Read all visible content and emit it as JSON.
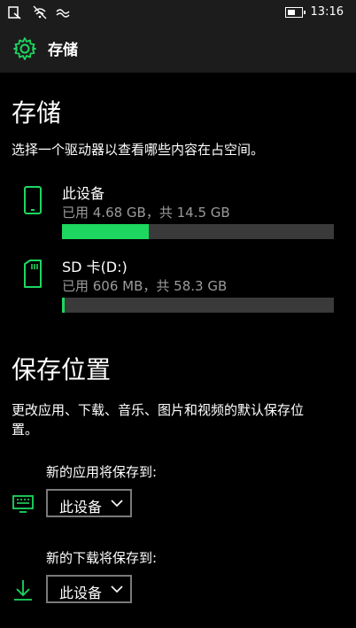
{
  "status_bar": {
    "time": "13:16"
  },
  "header": {
    "title": "存储"
  },
  "storage": {
    "heading": "存储",
    "description": "选择一个驱动器以查看哪些内容在占空间。",
    "drives": [
      {
        "name": "此设备",
        "usage": "已用 4.68 GB，共 14.5 GB",
        "used_fraction": 0.32
      },
      {
        "name": "SD 卡(D:)",
        "usage": "已用 606 MB，共 58.3 GB",
        "used_fraction": 0.01
      }
    ]
  },
  "save_locations": {
    "heading": "保存位置",
    "description_line1": "更改应用、下载、音乐、图片和视频的默认保存位",
    "description_line2": "置。",
    "settings": [
      {
        "label": "新的应用将保存到:",
        "value": "此设备",
        "icon": "app-icon"
      },
      {
        "label": "新的下载将保存到:",
        "value": "此设备",
        "icon": "download-icon"
      }
    ]
  },
  "colors": {
    "accent": "#1ed760",
    "bar_track": "#3a3a3a",
    "secondary_text": "#9a9a9a"
  }
}
